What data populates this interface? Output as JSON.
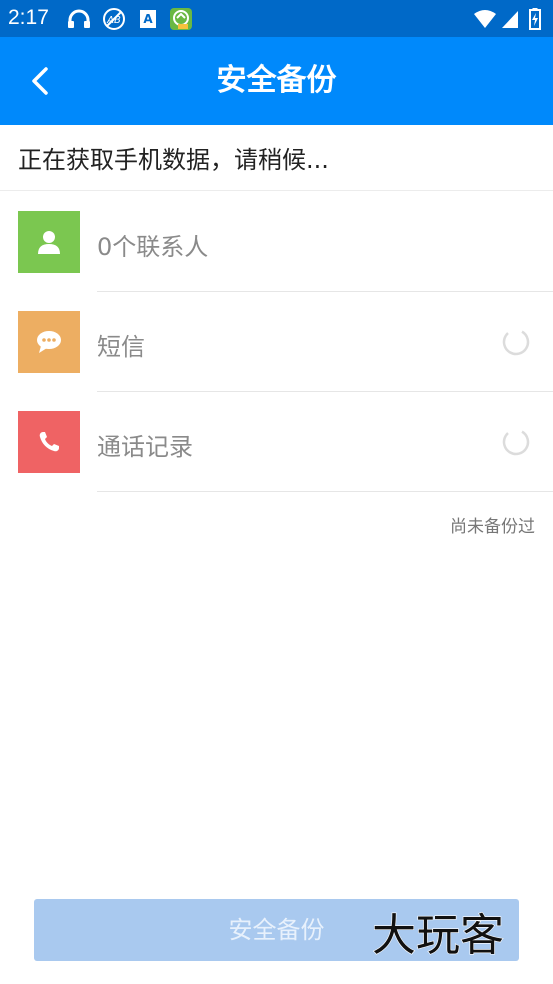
{
  "status_bar": {
    "time": "2:17",
    "icons": [
      "headset-icon",
      "ab-circle-icon",
      "a-box-icon",
      "app-badge-icon",
      "wifi-icon",
      "signal-icon",
      "battery-charging-icon"
    ]
  },
  "toolbar": {
    "back_icon": "back-arrow-icon",
    "title": "安全备份"
  },
  "progress_text": "正在获取手机数据，请稍候...",
  "items": [
    {
      "icon": "contact-icon",
      "color": "#7bc750",
      "label": "0个联系人",
      "loading": false
    },
    {
      "icon": "message-icon",
      "color": "#edae62",
      "label": "短信",
      "loading": true
    },
    {
      "icon": "phone-icon",
      "color": "#ef6364",
      "label": "通话记录",
      "loading": true
    }
  ],
  "backup_status": "尚未备份过",
  "backup_button": "安全备份",
  "watermark": "大玩客",
  "colors": {
    "status_bar": "#0069c8",
    "toolbar": "#0089fb",
    "button_disabled": "#a9c9ef"
  }
}
